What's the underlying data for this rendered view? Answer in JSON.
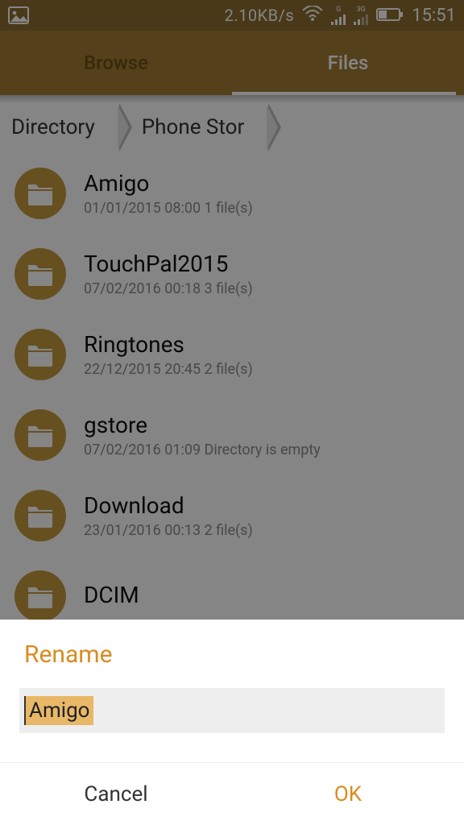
{
  "status": {
    "speed": "2.10KB/s",
    "time": "15:51",
    "net1": "G",
    "net2": "3G"
  },
  "tabs": {
    "browse": "Browse",
    "files": "Files"
  },
  "crumbs": {
    "a": "Directory",
    "b": "Phone Stor"
  },
  "folders": [
    {
      "name": "Amigo",
      "meta": "01/01/2015 08:00  1 file(s)"
    },
    {
      "name": "TouchPal2015",
      "meta": "07/02/2016 00:18  3 file(s)"
    },
    {
      "name": "Ringtones",
      "meta": "22/12/2015 20:45  2 file(s)"
    },
    {
      "name": "gstore",
      "meta": "07/02/2016 01:09  Directory is empty"
    },
    {
      "name": "Download",
      "meta": "23/01/2016 00:13  2 file(s)"
    },
    {
      "name": "DCIM",
      "meta": ""
    }
  ],
  "dialog": {
    "title": "Rename",
    "value": "Amigo",
    "cancel": "Cancel",
    "ok": "OK"
  }
}
